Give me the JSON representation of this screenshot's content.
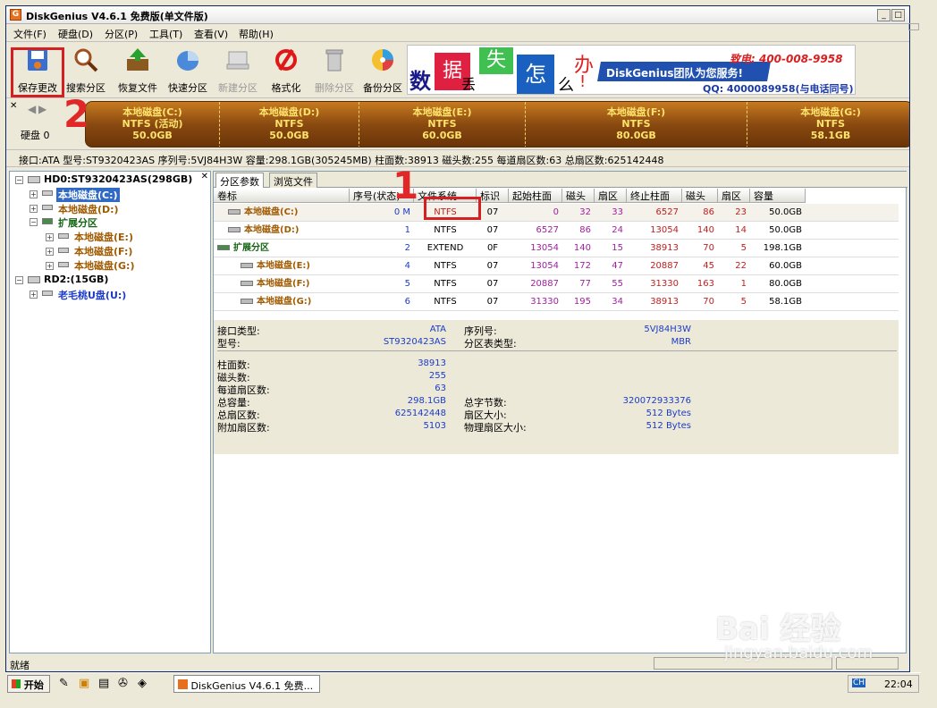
{
  "window": {
    "title": "DiskGenius V4.6.1 免费版(单文件版)",
    "app_icon": "G"
  },
  "menu": [
    "文件(F)",
    "硬盘(D)",
    "分区(P)",
    "工具(T)",
    "查看(V)",
    "帮助(H)"
  ],
  "toolbar": [
    {
      "label": "保存更改",
      "icon": "save-icon",
      "enabled": true
    },
    {
      "label": "搜索分区",
      "icon": "magnifier-icon",
      "enabled": true
    },
    {
      "label": "恢复文件",
      "icon": "recover-box-icon",
      "enabled": true
    },
    {
      "label": "快速分区",
      "icon": "quick-partition-icon",
      "enabled": true
    },
    {
      "label": "新建分区",
      "icon": "new-partition-icon",
      "enabled": false
    },
    {
      "label": "格式化",
      "icon": "format-icon",
      "enabled": true
    },
    {
      "label": "删除分区",
      "icon": "trash-icon",
      "enabled": false
    },
    {
      "label": "备份分区",
      "icon": "backup-disc-icon",
      "enabled": true
    }
  ],
  "banner": {
    "chars": [
      "数",
      "据",
      "丢",
      "失",
      "怎",
      "么",
      "办",
      "!"
    ],
    "brand": "DiskGenius团队为您服务!",
    "phone": "致电: 400-008-9958",
    "qq": "QQ: 4000089958(与电话同号)"
  },
  "diskbar": {
    "label": "硬盘 0",
    "partitions": [
      {
        "name": "本地磁盘(C:)",
        "fs": "NTFS (活动)",
        "size": "50.0GB"
      },
      {
        "name": "本地磁盘(D:)",
        "fs": "NTFS",
        "size": "50.0GB"
      },
      {
        "name": "本地磁盘(E:)",
        "fs": "NTFS",
        "size": "60.0GB"
      },
      {
        "name": "本地磁盘(F:)",
        "fs": "NTFS",
        "size": "80.0GB"
      },
      {
        "name": "本地磁盘(G:)",
        "fs": "NTFS",
        "size": "58.1GB"
      }
    ]
  },
  "diskinfo": "接口:ATA  型号:ST9320423AS  序列号:5VJ84H3W  容量:298.1GB(305245MB)  柱面数:38913  磁头数:255  每道扇区数:63  总扇区数:625142448",
  "tree": {
    "hd0": "HD0:ST9320423AS(298GB)",
    "c": "本地磁盘(C:)",
    "d": "本地磁盘(D:)",
    "ext": "扩展分区",
    "e": "本地磁盘(E:)",
    "f": "本地磁盘(F:)",
    "g": "本地磁盘(G:)",
    "rd2": "RD2:(15GB)",
    "u": "老毛桃U盘(U:)"
  },
  "tabs": [
    "分区参数",
    "浏览文件"
  ],
  "grid": {
    "headers": [
      "卷标",
      "序号(状态)",
      "文件系统",
      "标识",
      "起始柱面",
      "磁头",
      "扇区",
      "终止柱面",
      "磁头",
      "扇区",
      "容量"
    ],
    "rows": [
      {
        "label": "本地磁盘(C:)",
        "no": "0 M",
        "fs": "NTFS",
        "id": "07",
        "sc": "0",
        "sh": "32",
        "ss": "33",
        "ec": "6527",
        "eh": "86",
        "es": "23",
        "cap": "50.0GB"
      },
      {
        "label": "本地磁盘(D:)",
        "no": "1",
        "fs": "NTFS",
        "id": "07",
        "sc": "6527",
        "sh": "86",
        "ss": "24",
        "ec": "13054",
        "eh": "140",
        "es": "14",
        "cap": "50.0GB"
      },
      {
        "label": "扩展分区",
        "no": "2",
        "fs": "EXTEND",
        "id": "0F",
        "sc": "13054",
        "sh": "140",
        "ss": "15",
        "ec": "38913",
        "eh": "70",
        "es": "5",
        "cap": "198.1GB"
      },
      {
        "label": "本地磁盘(E:)",
        "no": "4",
        "fs": "NTFS",
        "id": "07",
        "sc": "13054",
        "sh": "172",
        "ss": "47",
        "ec": "20887",
        "eh": "45",
        "es": "22",
        "cap": "60.0GB"
      },
      {
        "label": "本地磁盘(F:)",
        "no": "5",
        "fs": "NTFS",
        "id": "07",
        "sc": "20887",
        "sh": "77",
        "ss": "55",
        "ec": "31330",
        "eh": "163",
        "es": "1",
        "cap": "80.0GB"
      },
      {
        "label": "本地磁盘(G:)",
        "no": "6",
        "fs": "NTFS",
        "id": "07",
        "sc": "31330",
        "sh": "195",
        "ss": "34",
        "ec": "38913",
        "eh": "70",
        "es": "5",
        "cap": "58.1GB"
      }
    ]
  },
  "details": {
    "iface_l": "接口类型:",
    "iface_v": "ATA",
    "serial_l": "序列号:",
    "serial_v": "5VJ84H3W",
    "model_l": "型号:",
    "model_v": "ST9320423AS",
    "pt_l": "分区表类型:",
    "pt_v": "MBR",
    "cyl_l": "柱面数:",
    "cyl_v": "38913",
    "head_l": "磁头数:",
    "head_v": "255",
    "spt_l": "每道扇区数:",
    "spt_v": "63",
    "cap_l": "总容量:",
    "cap_v": "298.1GB",
    "bytes_l": "总字节数:",
    "bytes_v": "320072933376",
    "sec_l": "总扇区数:",
    "sec_v": "625142448",
    "secsz_l": "扇区大小:",
    "secsz_v": "512 Bytes",
    "extra_l": "附加扇区数:",
    "extra_v": "5103",
    "phys_l": "物理扇区大小:",
    "phys_v": "512 Bytes"
  },
  "status": "就绪",
  "taskbar": {
    "start": "开始",
    "task": "DiskGenius V4.6.1 免费...",
    "tray_lang": "CH",
    "clock": "22:04"
  },
  "annotations": {
    "one": "1",
    "two": "2"
  },
  "watermark": {
    "brand": "Bai 经验",
    "url": "jingyan.baidu.com"
  }
}
